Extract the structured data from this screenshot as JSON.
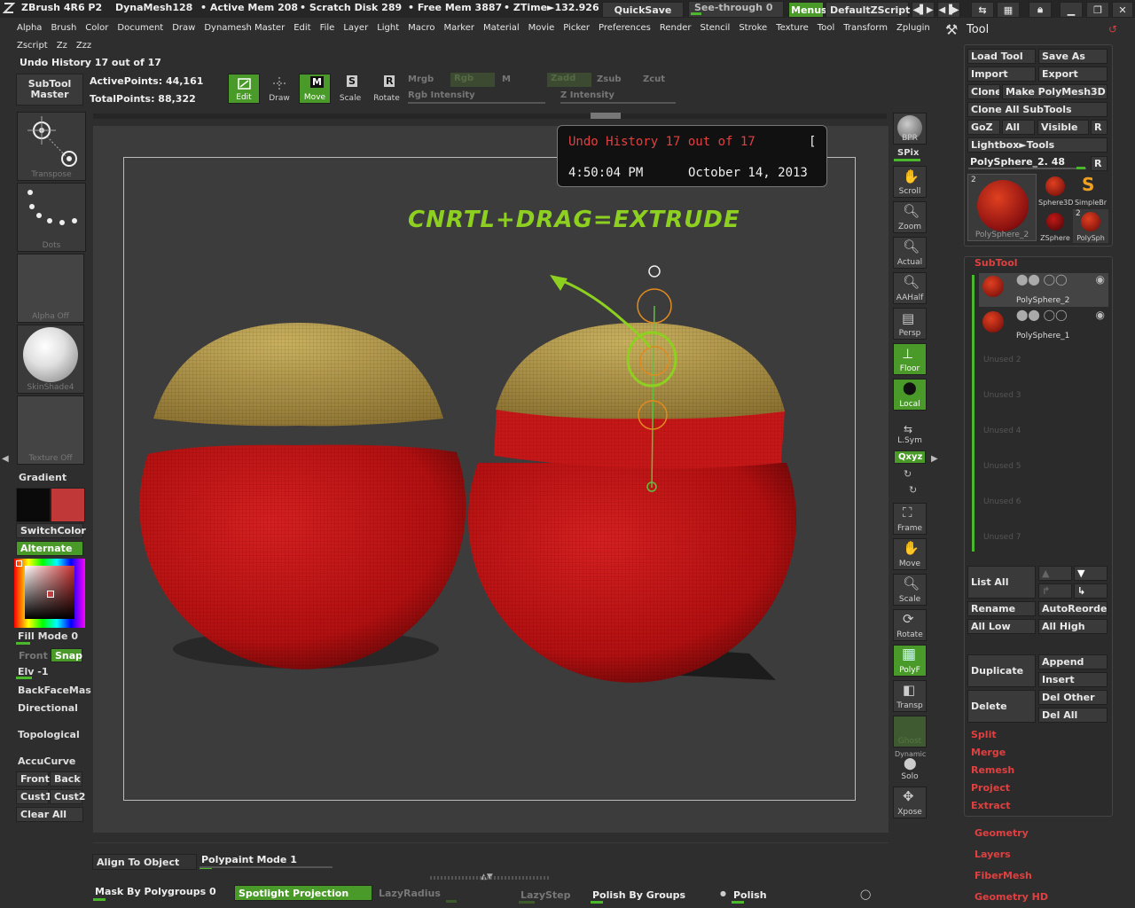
{
  "titlebar": {
    "app": "ZBrush 4R6 P2",
    "dynamesh": "DynaMesh128",
    "active_mem": "• Active Mem 208",
    "scratch": "• Scratch Disk 289",
    "free_mem": "• Free Mem 3887",
    "ztime": "• ZTime►132.926",
    "quicksave": "QuickSave",
    "see_through": "See-through  0",
    "menus": "Menus",
    "script": "DefaultZScript"
  },
  "menubar": [
    "Alpha",
    "Brush",
    "Color",
    "Document",
    "Draw",
    "Dynamesh Master",
    "Edit",
    "File",
    "Layer",
    "Light",
    "Macro",
    "Marker",
    "Material",
    "Movie",
    "Picker",
    "Preferences",
    "Render",
    "Stencil",
    "Stroke",
    "Texture",
    "Tool",
    "Transform",
    "Zplugin"
  ],
  "menubar2": [
    "Zscript",
    "Zz",
    "Zzz"
  ],
  "undo_header": "Undo History 17 out of 17",
  "subtool_master": "SubTool Master",
  "points": {
    "active": "ActivePoints: 44,161",
    "total": "TotalPoints: 88,322"
  },
  "toolbar": {
    "edit": "Edit",
    "draw": "Draw",
    "move": "Move",
    "scale": "Scale",
    "rotate": "Rotate",
    "mrgb": "Mrgb",
    "rgb": "Rgb",
    "m": "M",
    "rgb_intensity": "Rgb Intensity",
    "zadd": "Zadd",
    "zsub": "Zsub",
    "zcut": "Zcut",
    "z_intensity": "Z Intensity"
  },
  "left": {
    "transpose": "Transpose",
    "dots": "Dots",
    "alpha_off": "Alpha  Off",
    "skinshade": "SkinShade4",
    "texture_off": "Texture  Off",
    "gradient": "Gradient",
    "switchcolor": "SwitchColor",
    "alternate": "Alternate",
    "fill_mode": "Fill Mode 0",
    "front": "Front",
    "snap": "Snap",
    "elv": "Elv -1",
    "backface": "BackFaceMas",
    "directional": "Directional",
    "topological": "Topological",
    "accucurve": "AccuCurve",
    "front2": "Front",
    "back": "Back",
    "cust1": "Cust1",
    "cust2": "Cust2",
    "clear_all": "Clear  All",
    "primary_color": "#0a0a0a",
    "secondary_color": "#c03838"
  },
  "canvas": {
    "overlay_title": "Undo History 17 out of 17",
    "overlay_bracket": "[",
    "overlay_time": "4:50:04 PM",
    "overlay_date": "October 14, 2013",
    "annotation": "CNRTL+DRAG=EXTRUDE"
  },
  "right_tools": {
    "bpr": "BPR",
    "spix": "SPix",
    "scroll": "Scroll",
    "zoom": "Zoom",
    "actual": "Actual",
    "aahalf": "AAHalf",
    "persp": "Persp",
    "floor": "Floor",
    "local": "Local",
    "lsym": "L.Sym",
    "xyz": "Qxyz",
    "frame": "Frame",
    "move": "Move",
    "scale": "Scale",
    "rotate": "Rotate",
    "polyf": "PolyF",
    "transp": "Transp",
    "ghost": "Ghost",
    "dynamic": "Dynamic",
    "solo": "Solo",
    "xpose": "Xpose"
  },
  "tool_panel": {
    "title": "Tool",
    "load_tool": "Load Tool",
    "save_as": "Save As",
    "import": "Import",
    "export": "Export",
    "clone": "Clone",
    "make_polymesh": "Make PolyMesh3D",
    "clone_all": "Clone  All SubTools",
    "goz": "GoZ",
    "all": "All",
    "visible": "Visible",
    "r": "R",
    "lightbox": "Lightbox►Tools",
    "current_tool": "PolySphere_2. 48",
    "thumbs": [
      {
        "label": "PolySphere_2",
        "badge": "2"
      },
      {
        "label": "Sphere3D",
        "badge": ""
      },
      {
        "label": "SimpleBr",
        "badge": ""
      },
      {
        "label": "ZSphere",
        "badge": ""
      },
      {
        "label": "PolySph",
        "badge": "2"
      }
    ],
    "subtool_title": "SubTool",
    "subtools": [
      "PolySphere_2",
      "PolySphere_1"
    ],
    "unused": [
      "Unused 2",
      "Unused 3",
      "Unused 4",
      "Unused 5",
      "Unused 6",
      "Unused 7"
    ],
    "list_all": "List  All",
    "rename": "Rename",
    "autoreorder": "AutoReorder",
    "all_low": "All Low",
    "all_high": "All High",
    "duplicate": "Duplicate",
    "append": "Append",
    "insert": "Insert",
    "delete": "Delete",
    "del_other": "Del Other",
    "del_all": "Del All",
    "split": "Split",
    "merge": "Merge",
    "remesh": "Remesh",
    "project": "Project",
    "extract": "Extract",
    "geometry": "Geometry",
    "layers": "Layers",
    "fibermesh": "FiberMesh",
    "geometry_hd": "Geometry HD"
  },
  "bottom": {
    "align": "Align To Object",
    "polypaint": "Polypaint Mode 1",
    "mask_polygroups": "Mask By Polygroups 0",
    "spotlight": "Spotlight Projection",
    "lazyradius": "LazyRadius",
    "lazystep": "LazyStep",
    "polish_groups": "Polish By Groups",
    "polish": "Polish"
  },
  "colors": {
    "accent_green": "#4a9a2a",
    "sphere_red": "#c41a1a",
    "cap_yellow": "#b8a050",
    "overlay_red": "#e04040",
    "annotation_green": "#8ed020"
  }
}
